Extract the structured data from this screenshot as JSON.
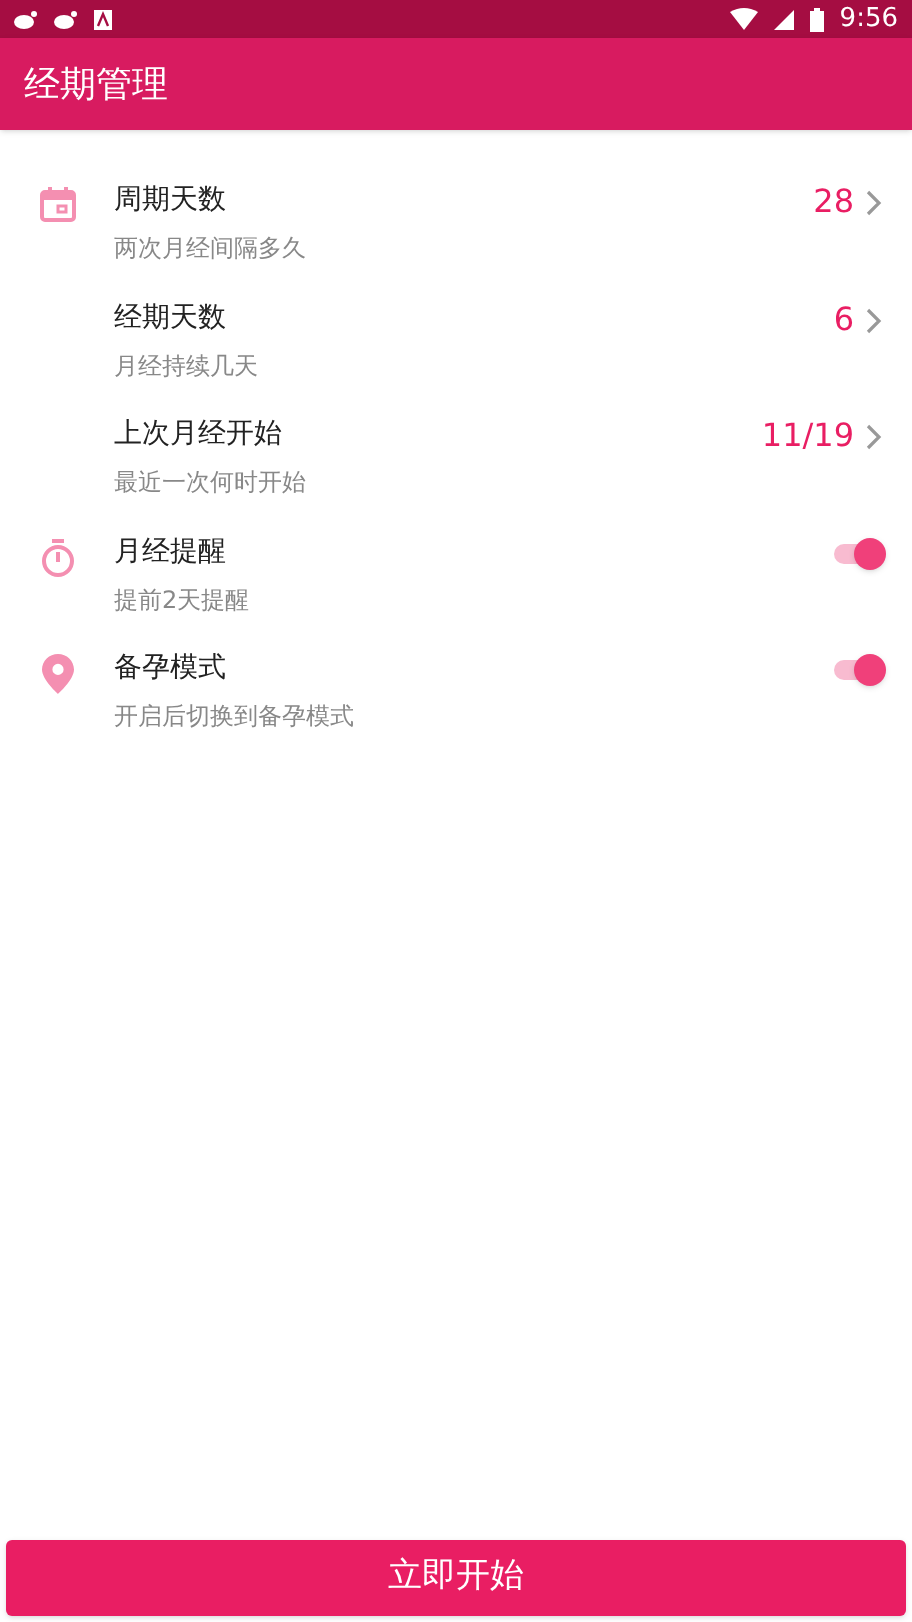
{
  "status_bar": {
    "time": "9:56"
  },
  "app_bar": {
    "title": "经期管理"
  },
  "settings": [
    {
      "kind": "value",
      "title": "周期天数",
      "subtitle": "两次月经间隔多久",
      "value": "28"
    },
    {
      "kind": "value",
      "title": "经期天数",
      "subtitle": "月经持续几天",
      "value": "6"
    },
    {
      "kind": "value",
      "title": "上次月经开始",
      "subtitle": "最近一次何时开始",
      "value": "11/19"
    },
    {
      "kind": "toggle",
      "title": "月经提醒",
      "subtitle": "提前2天提醒",
      "on": true
    },
    {
      "kind": "toggle",
      "title": "备孕模式",
      "subtitle": "开启后切换到备孕模式",
      "on": true
    }
  ],
  "start_button": {
    "label": "立即开始"
  }
}
